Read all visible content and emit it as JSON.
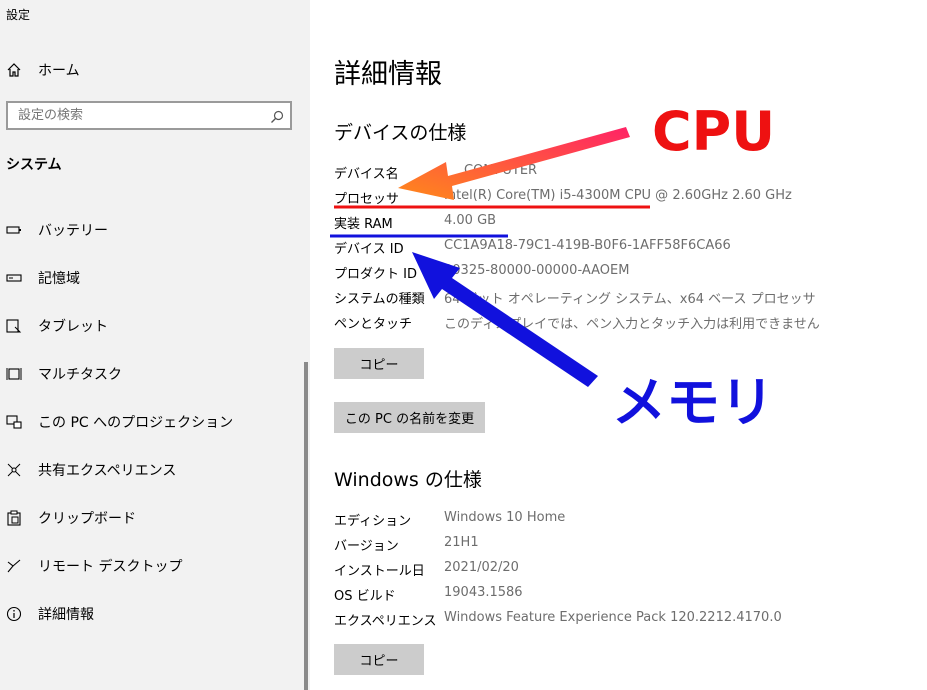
{
  "window": {
    "title": "設定"
  },
  "sidebar": {
    "home_label": "ホーム",
    "search_placeholder": "設定の検索",
    "section_heading": "システム",
    "items": [
      {
        "label": "バッテリー",
        "icon": "battery-icon"
      },
      {
        "label": "記憶域",
        "icon": "storage-icon"
      },
      {
        "label": "タブレット",
        "icon": "tablet-icon"
      },
      {
        "label": "マルチタスク",
        "icon": "multitasking-icon"
      },
      {
        "label": "この PC へのプロジェクション",
        "icon": "projection-icon"
      },
      {
        "label": "共有エクスペリエンス",
        "icon": "shared-experiences-icon"
      },
      {
        "label": "クリップボード",
        "icon": "clipboard-icon"
      },
      {
        "label": "リモート デスクトップ",
        "icon": "remote-desktop-icon"
      },
      {
        "label": "詳細情報",
        "icon": "info-icon"
      }
    ]
  },
  "main": {
    "title": "詳細情報",
    "device_specs": {
      "heading": "デバイスの仕様",
      "rows": [
        {
          "key": "デバイス名",
          "value": "COMPUTER"
        },
        {
          "key": "プロセッサ",
          "value": "Intel(R) Core(TM) i5-4300M CPU @ 2.60GHz   2.60 GHz"
        },
        {
          "key": "実装 RAM",
          "value": "4.00 GB"
        },
        {
          "key": "デバイス ID",
          "value": "CC1A9A18-79C1-419B-B0F6-1AFF58F6CA66"
        },
        {
          "key": "プロダクト ID",
          "value": "00325-80000-00000-AAOEM"
        },
        {
          "key": "システムの種類",
          "value": "64 ビット オペレーティング システム、x64 ベース プロセッサ"
        },
        {
          "key": "ペンとタッチ",
          "value": "このディスプレイでは、ペン入力とタッチ入力は利用できません"
        }
      ],
      "copy_button": "コピー",
      "rename_button": "この PC の名前を変更"
    },
    "windows_specs": {
      "heading": "Windows の仕様",
      "rows": [
        {
          "key": "エディション",
          "value": "Windows 10 Home"
        },
        {
          "key": "バージョン",
          "value": "21H1"
        },
        {
          "key": "インストール日",
          "value": "2021/02/20"
        },
        {
          "key": "OS ビルド",
          "value": "19043.1586"
        },
        {
          "key": "エクスペリエンス",
          "value": "Windows Feature Experience Pack 120.2212.4170.0"
        }
      ],
      "copy_button": "コピー"
    }
  },
  "annotations": {
    "cpu_label": "CPU",
    "memory_label": "メモリ",
    "cpu_color": "#ee1111",
    "memory_color": "#1111dd",
    "arrow_orange": "#ff8a1a",
    "arrow_pink": "#ff2266"
  }
}
